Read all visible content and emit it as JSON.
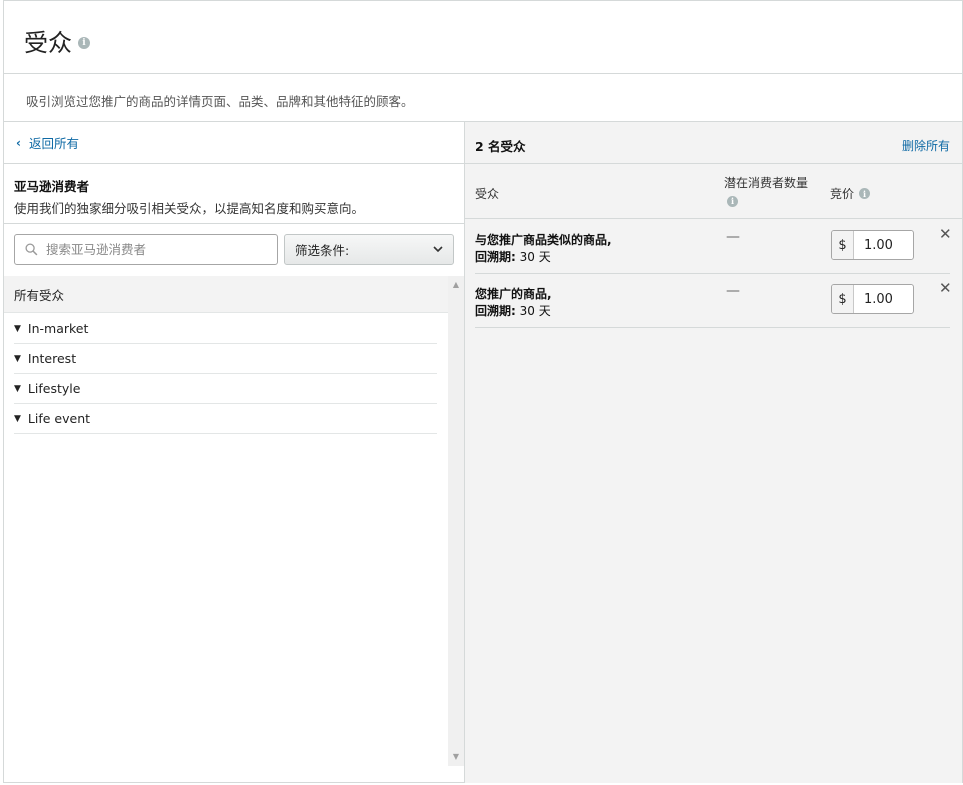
{
  "header": {
    "title": "受众",
    "info": "i"
  },
  "subtitle": "吸引浏览过您推广的商品的详情页面、品类、品牌和其他特征的顾客。",
  "left": {
    "back_label": "返回所有",
    "category_title": "亚马逊消费者",
    "category_desc": "使用我们的独家细分吸引相关受众，以提高知名度和购买意向。",
    "search_placeholder": "搜索亚马逊消费者",
    "filter_label": "筛选条件:",
    "list_header": "所有受众",
    "items": [
      {
        "label": "In-market"
      },
      {
        "label": "Interest"
      },
      {
        "label": "Lifestyle"
      },
      {
        "label": "Life event"
      }
    ]
  },
  "right": {
    "count_label": "2 名受众",
    "remove_all": "删除所有",
    "columns": {
      "audience": "受众",
      "reach": "潜在消费者数量",
      "bid": "竞价"
    },
    "rows": [
      {
        "name": "与您推广商品类似的商品,",
        "lookback_label": "回溯期:",
        "lookback_value": " 30 天",
        "reach": "—",
        "currency": "$",
        "bid": "1.00",
        "remove": "✕"
      },
      {
        "name": "您推广的商品,",
        "lookback_label": "回溯期:",
        "lookback_value": " 30 天",
        "reach": "—",
        "currency": "$",
        "bid": "1.00",
        "remove": "✕"
      }
    ]
  }
}
